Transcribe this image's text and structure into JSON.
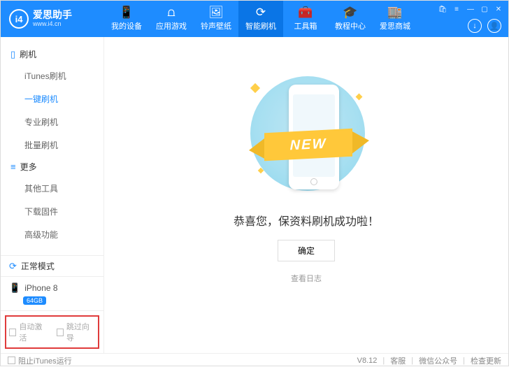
{
  "app": {
    "name_cn": "爱思助手",
    "name_en": "www.i4.cn",
    "logo_letters": "i4"
  },
  "nav": [
    {
      "label": "我的设备",
      "icon": "📱"
    },
    {
      "label": "应用游戏",
      "icon": "⩍"
    },
    {
      "label": "铃声壁纸",
      "icon": "🖼"
    },
    {
      "label": "智能刷机",
      "icon": "⟳",
      "active": true
    },
    {
      "label": "工具箱",
      "icon": "🧰"
    },
    {
      "label": "教程中心",
      "icon": "🎓"
    },
    {
      "label": "爱思商城",
      "icon": "🏬"
    }
  ],
  "sidebar": {
    "section1": {
      "title": "刷机",
      "items": [
        "iTunes刷机",
        "一键刷机",
        "专业刷机",
        "批量刷机"
      ],
      "active_index": 1
    },
    "section2": {
      "title": "更多",
      "items": [
        "其他工具",
        "下载固件",
        "高级功能"
      ]
    }
  },
  "status": {
    "mode": "正常模式"
  },
  "device": {
    "name": "iPhone 8",
    "storage": "64GB"
  },
  "options": {
    "auto_activate": "自动激活",
    "skip_wizard": "跳过向导"
  },
  "content": {
    "ribbon": "NEW",
    "success": "恭喜您，保资料刷机成功啦！",
    "ok": "确定",
    "log": "查看日志"
  },
  "footer": {
    "block_itunes": "阻止iTunes运行",
    "version": "V8.12",
    "links": [
      "客服",
      "微信公众号",
      "检查更新"
    ]
  }
}
